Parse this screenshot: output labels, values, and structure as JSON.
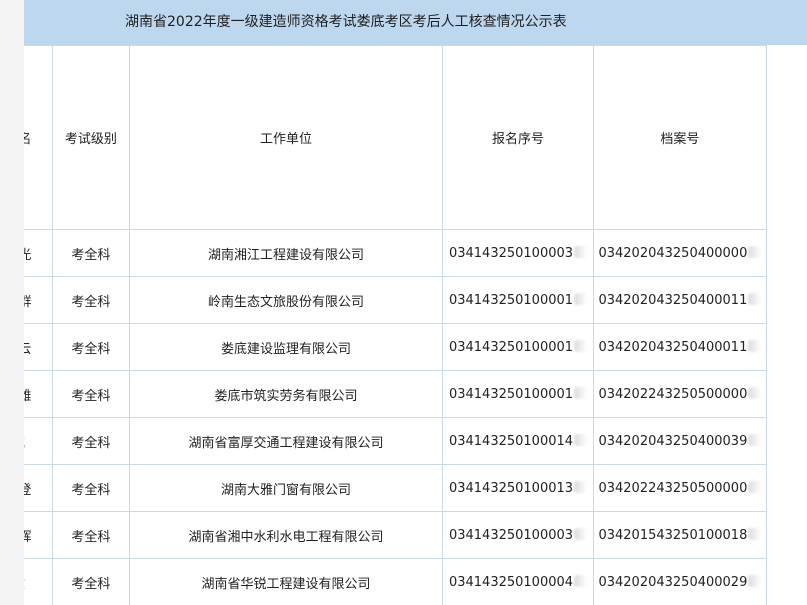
{
  "title": "湖南省2022年度一级建造师资格考试娄底考区考后人工核查情况公示表",
  "headers": {
    "name": "姓名",
    "level": "考试级别",
    "unit": "工作单位",
    "reg_no": "报名序号",
    "file_no": "档案号"
  },
  "rows": [
    {
      "name": "志光",
      "level": "考全科",
      "unit": "湖南湘江工程建设有限公司",
      "reg_no": "034143250100003",
      "file_no": "034202043250400000"
    },
    {
      "name": "跃群",
      "level": "考全科",
      "unit": "岭南生态文旅股份有限公司",
      "reg_no": "034143250100001",
      "file_no": "034202043250400011"
    },
    {
      "name": "采云",
      "level": "考全科",
      "unit": "娄底建设监理有限公司",
      "reg_no": "034143250100001",
      "file_no": "034202043250400011"
    },
    {
      "name": "世雄",
      "level": "考全科",
      "unit": "娄底市筑实劳务有限公司",
      "reg_no": "034143250100001",
      "file_no": "034202243250500000"
    },
    {
      "name": "威",
      "level": "考全科",
      "unit": "湖南省富厚交通工程建设有限公司",
      "reg_no": "034143250100014",
      "file_no": "034202043250400039"
    },
    {
      "name": "应登",
      "level": "考全科",
      "unit": "湖南大雅门窗有限公司",
      "reg_no": "034143250100013",
      "file_no": "034202243250500000"
    },
    {
      "name": "欣辉",
      "level": "考全科",
      "unit": "湖南省湘中水利水电工程有限公司",
      "reg_no": "034143250100003",
      "file_no": "034201543250100018"
    },
    {
      "name": "健",
      "level": "考全科",
      "unit": "湖南省华锐工程建设有限公司",
      "reg_no": "034143250100004",
      "file_no": "034202043250400029"
    }
  ]
}
